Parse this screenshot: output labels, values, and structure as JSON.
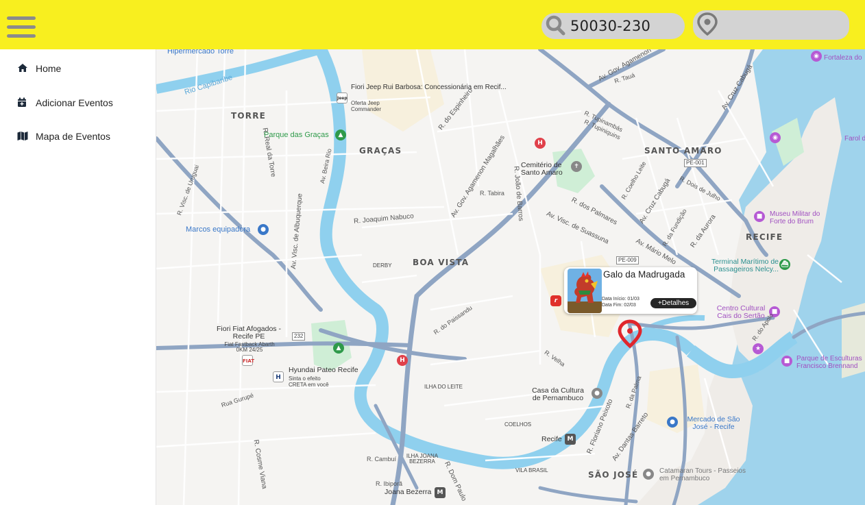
{
  "header": {
    "search_value": "50030-230",
    "search_icon": "search-icon",
    "location_icon": "map-pin-icon",
    "menu_icon": "hamburger-menu-icon",
    "bg_color": "#f8ef1f"
  },
  "sidebar": {
    "items": [
      {
        "label": "Home",
        "icon": "home-icon"
      },
      {
        "label": "Adicionar Eventos",
        "icon": "calendar-add-icon"
      },
      {
        "label": "Mapa de Eventos",
        "icon": "map-icon"
      }
    ]
  },
  "map": {
    "districts": [
      "TORRE",
      "GRAÇAS",
      "SANTO AMARO",
      "RECIFE",
      "BOA VISTA",
      "DERBY",
      "ILHA DO LEITE",
      "COELHOS",
      "ILHA JOANA BEZERRA",
      "VILA BRASIL",
      "SÃO JOSÉ"
    ],
    "places": {
      "hipermercado": "Hipermercado Torre",
      "fiori_jeep": "Fiori Jeep Rui Barbosa: Concessionária em Recif...",
      "fiori_jeep_sub1": "Oferta Jeep",
      "fiori_jeep_sub2": "Commander",
      "parque_gracas": "Parque das Graças",
      "cemiterio": "Cemitério de Santo Amaro",
      "marcos": "Marcos equipadora",
      "museu": "Museu Militar do Forte do Brum",
      "terminal": "Terminal Marítimo de Passageiros Nelcy...",
      "centro_cultural": "Centro Cultural Cais do Sertão",
      "parque_escultura": "Parque de Esculturas Francisco Brennand",
      "fortaleza": "Fortaleza do",
      "farol": "Farol d",
      "fiori_fiat": "Fiori Fiat Afogados - Recife PE",
      "fiori_fiat_sub": "Fiat Fastback Abarth 0KM 24/25",
      "hyundai": "Hyundai Pateo Recife",
      "hyundai_sub1": "Sinta o efeito",
      "hyundai_sub2": "CRETA em você",
      "casa_cultura": "Casa da Cultura de Pernambuco",
      "mercado": "Mercado de São José - Recife",
      "recife_station": "Recife",
      "catamaran": "Catamaran Tours - Passeios em Pernambuco",
      "joana_bezerra": "Joana Bezerra"
    },
    "streets": {
      "rio_capibaribe": "Rio Capibaribe",
      "gov_agamenon": "Av. Gov. Agamenon Magalhães",
      "gov_agamenon_top": "Av. Gov. Agamenon",
      "joaquim_nabuco": "R. Joaquim Nabuco",
      "do_espinheiro": "R. do Espinheiro",
      "cruz_cabuga": "Av. Cruz Cabugá",
      "cruz_cabuga_top": "Av. Cruz Cabugá",
      "visc_suassuna": "Av. Visc. de Suassuna",
      "dos_palmares": "R. dos Palmares",
      "joao_barros": "R. João de Barros",
      "tabira": "R. Tabira",
      "da_aurora": "R. da Aurora",
      "mario_melo": "Av. Mário Melo",
      "real_torre": "R. Real da Torre",
      "visc_albuquerque": "Av. Visc. de Albuquerque",
      "beira_rio": "Av. Beira Rio",
      "do_paissandu": "R. do Paissandu",
      "velha": "R. Velha",
      "da_palma": "R. da Palma",
      "dantas_barreto": "Av. Dantas Barreto",
      "floriano_peixoto": "R. Floriano Peixoto",
      "dom_paulo": "R. Dom Paulo",
      "cosme_viana": "R. Cosme Viana",
      "rua_gurupe": "Rua Gurupé",
      "ibipora": "R. Ibiporã",
      "cambui": "R. Cambuí",
      "visc_uruguai": "R. Visc. de Uruguai",
      "tupinambas": "R. Tupinambás",
      "tupiniquins": "R. Tupiniquins",
      "dois_julho": "R. Dois de Julho",
      "coelho_leite": "R. Coelho Leite",
      "da_fundicao": "R. da Fundição",
      "do_apolo": "R. do Apolo",
      "r_taua": "R. Tauá",
      "pe001": "PE-001",
      "pe009": "PE-009",
      "r232": "232"
    }
  },
  "event": {
    "title": "Galo da Madrugada",
    "start_label": "Data Início:",
    "start_value": "01/03",
    "end_label": "Data Fim:",
    "end_value": "02/03",
    "details_label": "+Detalhes",
    "pin_color": "#e0262c"
  }
}
